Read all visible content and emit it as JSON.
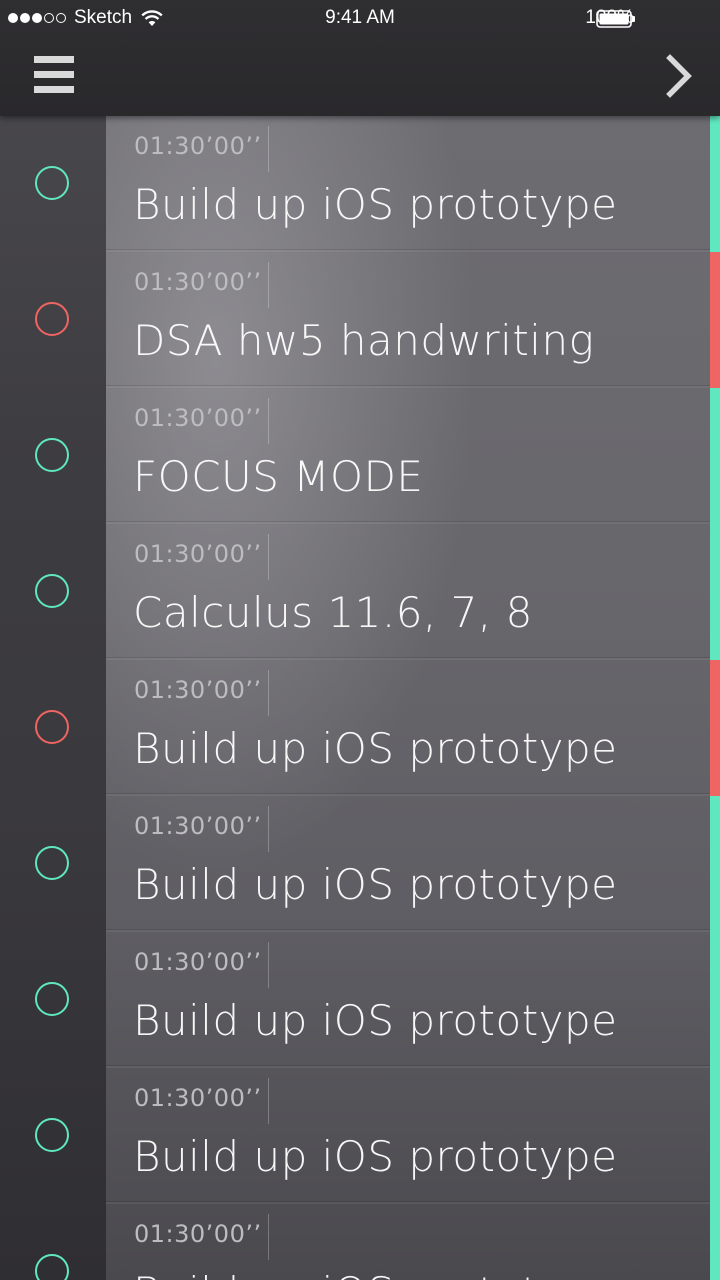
{
  "status_bar": {
    "carrier": "Sketch",
    "time": "9:41 AM",
    "battery": "100%",
    "signal_bars_filled": 3,
    "signal_bars_total": 5
  },
  "nav": {
    "menu_icon": "hamburger-menu-icon",
    "next_icon": "chevron-right-icon"
  },
  "colors": {
    "done": "#5fe8c0",
    "overdue": "#ef6563"
  },
  "tasks": [
    {
      "duration": "01:30’00’’",
      "title": "Build up iOS prototype",
      "status": "green"
    },
    {
      "duration": "01:30’00’’",
      "title": "DSA hw5 handwriting",
      "status": "red"
    },
    {
      "duration": "01:30’00’’",
      "title": "FOCUS MODE",
      "status": "green"
    },
    {
      "duration": "01:30’00’’",
      "title": "Calculus 11.6, 7, 8",
      "status": "green"
    },
    {
      "duration": "01:30’00’’",
      "title": "Build up iOS prototype",
      "status": "red"
    },
    {
      "duration": "01:30’00’’",
      "title": "Build up iOS prototype",
      "status": "green"
    },
    {
      "duration": "01:30’00’’",
      "title": "Build up iOS prototype",
      "status": "green"
    },
    {
      "duration": "01:30’00’’",
      "title": "Build up iOS prototype",
      "status": "green"
    },
    {
      "duration": "01:30’00’’",
      "title": "Build up iOS prototype",
      "status": "green"
    }
  ]
}
